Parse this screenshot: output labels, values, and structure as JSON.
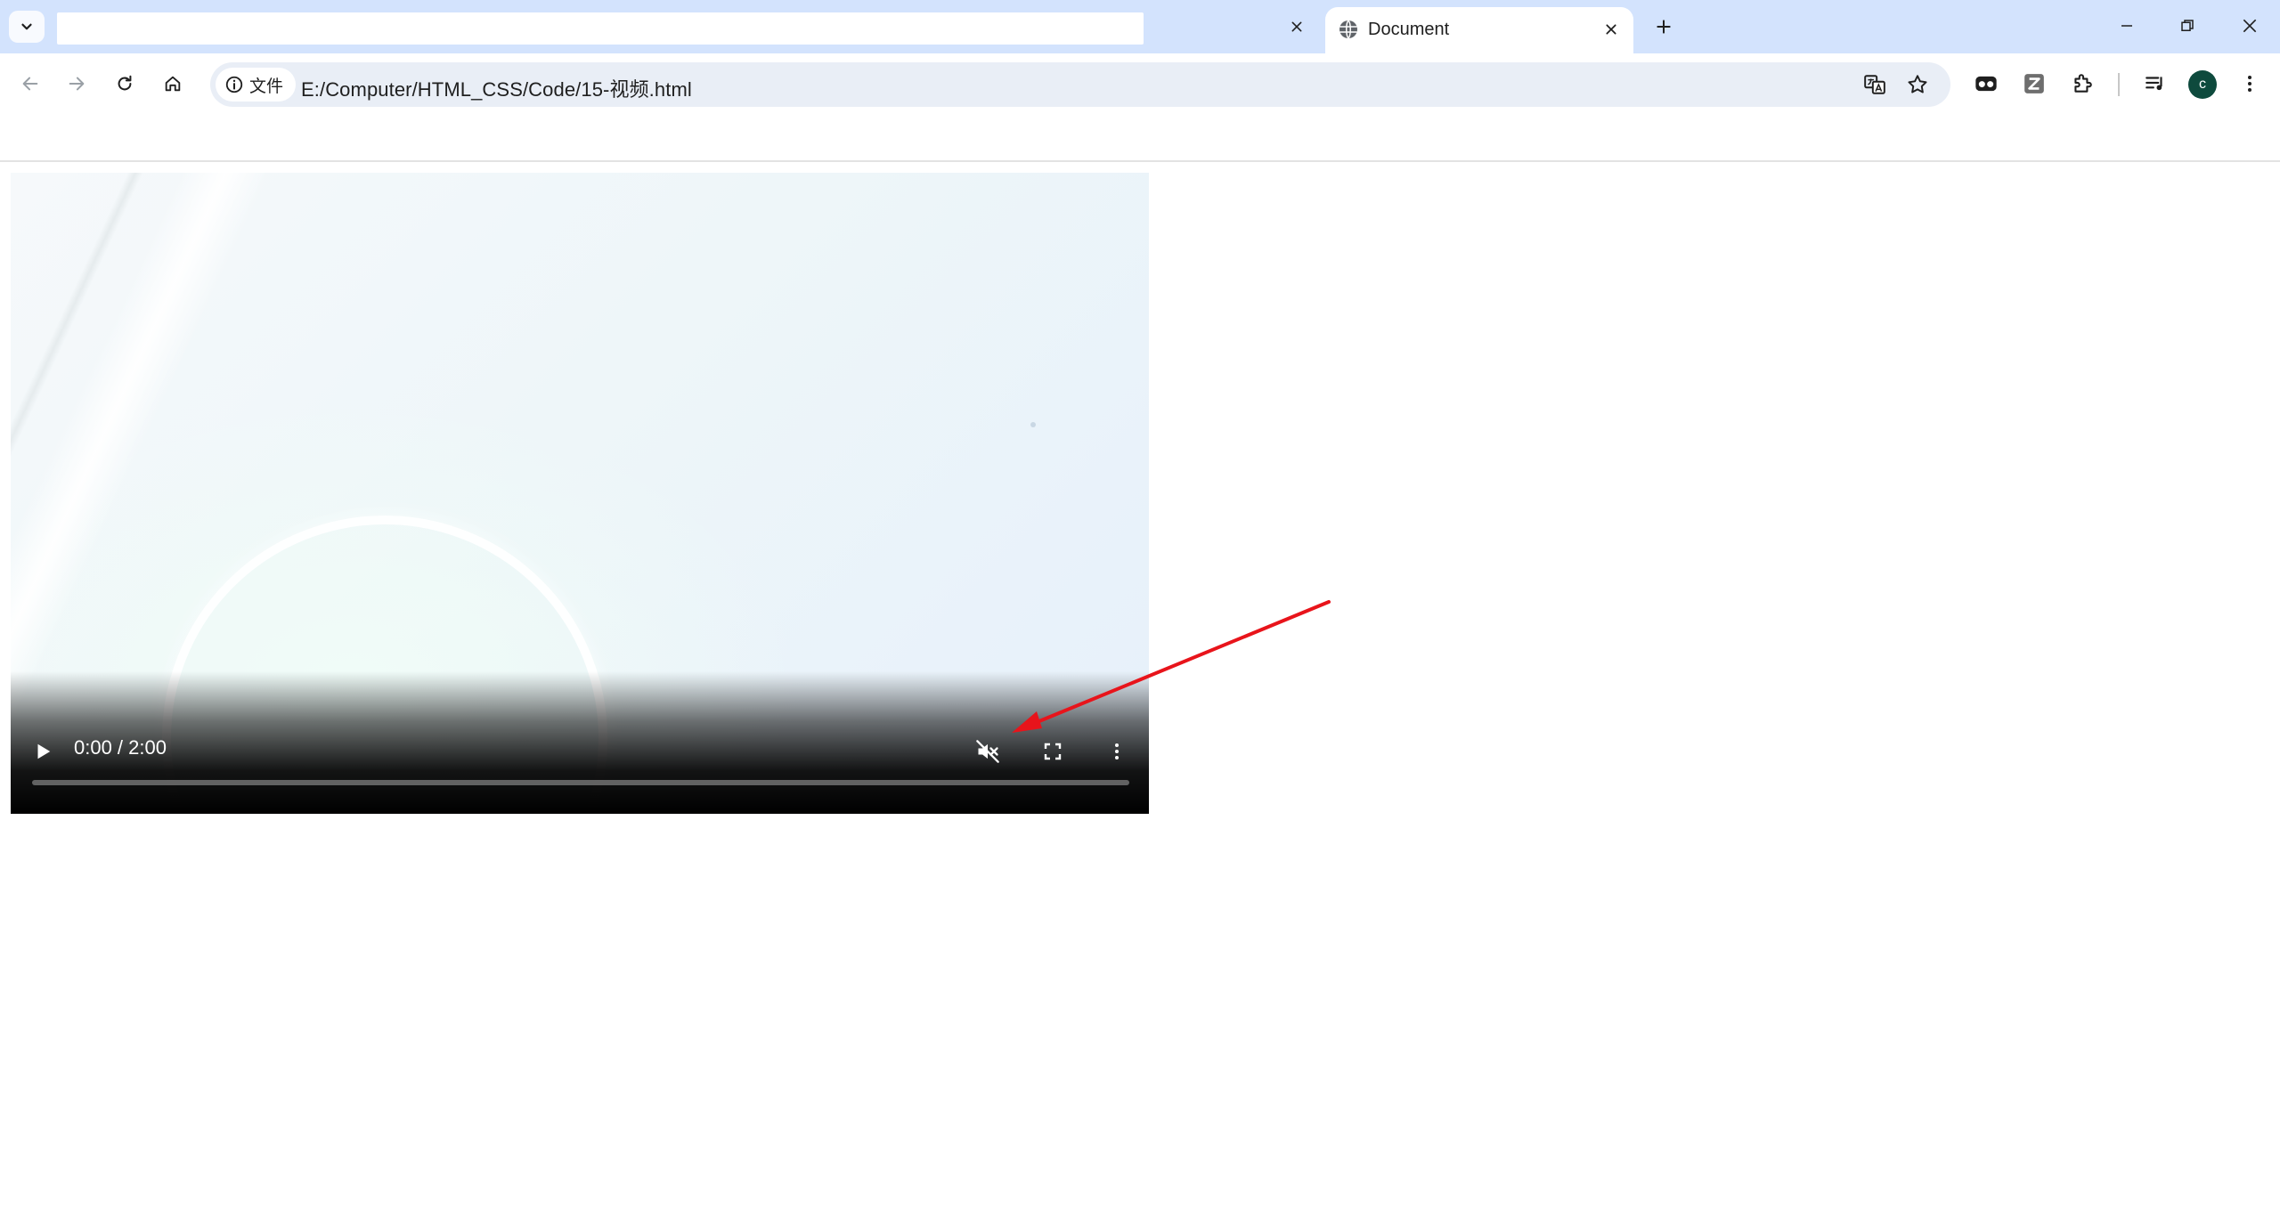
{
  "browser": {
    "active_tab": {
      "title": "Document"
    },
    "omnibox": {
      "chip_label": "文件",
      "url": "E:/Computer/HTML_CSS/Code/15-视频.html"
    },
    "profile_initial": "c",
    "accent_color": "#d3e3fd"
  },
  "video": {
    "time_display": "0:00 / 2:00",
    "progress_fraction": 0,
    "muted": true
  },
  "icons": {
    "tab_list": "chevron-down-icon",
    "close": "close-icon",
    "favicon": "globe-icon",
    "new_tab": "plus-icon",
    "back": "arrow-left-icon",
    "forward": "arrow-right-icon",
    "reload": "reload-icon",
    "home": "home-icon",
    "info": "info-icon",
    "translate": "translate-icon",
    "bookmark": "star-icon",
    "extension_a": "glasses-icon",
    "extension_z": "zotero-icon",
    "extensions": "puzzle-icon",
    "media": "media-control-icon",
    "menu": "kebab-menu-icon",
    "play": "play-icon",
    "mute": "volume-muted-icon",
    "fullscreen": "fullscreen-icon",
    "video_menu": "kebab-menu-icon"
  },
  "annotation": {
    "arrow_color": "#e8141b"
  }
}
